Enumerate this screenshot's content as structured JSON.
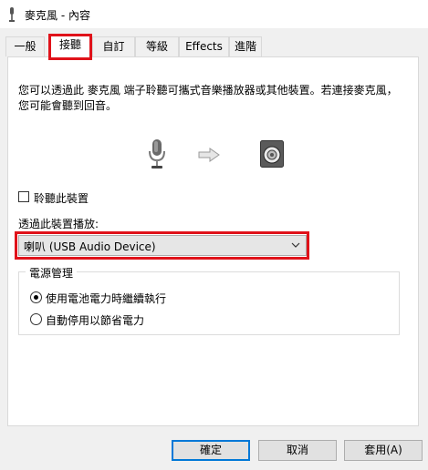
{
  "window": {
    "title": "麥克風 - 內容"
  },
  "tabs": [
    {
      "label": "一般"
    },
    {
      "label": "接聽"
    },
    {
      "label": "自訂"
    },
    {
      "label": "等級"
    },
    {
      "label": "Effects"
    },
    {
      "label": "進階"
    }
  ],
  "listen": {
    "description": "您可以透過此 麥克風 端子聆聽可攜式音樂播放器或其他裝置。若連接麥克風，您可能會聽到回音。",
    "listen_checkbox_label": "聆聽此裝置",
    "listen_checked": false,
    "playback_label": "透過此裝置播放:",
    "playback_device": "喇叭 (USB Audio Device)"
  },
  "power": {
    "group_title": "電源管理",
    "options": [
      {
        "label": "使用電池電力時繼續執行",
        "checked": true
      },
      {
        "label": "自動停用以節省電力",
        "checked": false
      }
    ]
  },
  "buttons": {
    "ok": "確定",
    "cancel": "取消",
    "apply": "套用(A)"
  },
  "colors": {
    "highlight": "#e0121a",
    "focus_border": "#0078d7",
    "background": "#f0f0f0"
  }
}
